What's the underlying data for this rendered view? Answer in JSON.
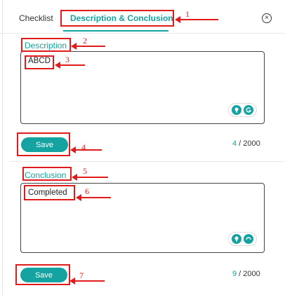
{
  "header": {
    "tab_checklist": "Checklist",
    "tab_description_conclusion": "Description & Conclusion",
    "close_icon": "×"
  },
  "description": {
    "label": "Description",
    "value": "ABCD",
    "save_label": "Save",
    "counter_current": "4",
    "counter_sep": " / ",
    "counter_max": "2000"
  },
  "conclusion": {
    "label": "Conclusion",
    "value": "Completed",
    "save_label": "Save",
    "counter_current": "9",
    "counter_sep": " / ",
    "counter_max": "2000"
  },
  "annotations": [
    "1",
    "2",
    "3",
    "4",
    "5",
    "6",
    "7"
  ],
  "colors": {
    "accent": "#14a3a0",
    "annotation": "#e01b1b"
  }
}
